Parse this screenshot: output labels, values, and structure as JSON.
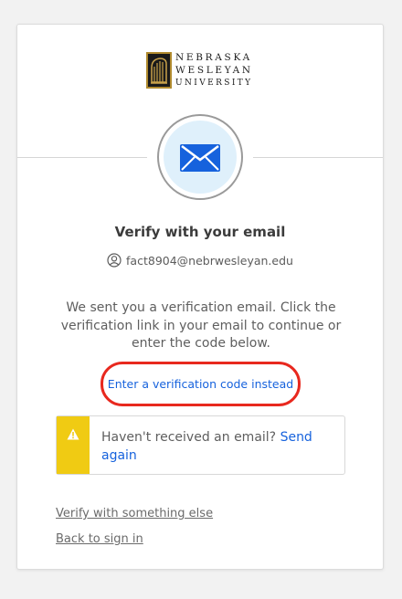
{
  "brand": {
    "line1": "NEBRASKA",
    "line2": "WESLEYAN",
    "line3": "UNIVERSITY"
  },
  "page": {
    "title": "Verify with your email",
    "identifier": "fact8904@nebrwesleyan.edu",
    "instructions": "We sent you a verification email. Click the verification link in your email to continue or enter the code below.",
    "code_link": "Enter a verification code instead"
  },
  "callout": {
    "message": "Haven't received an email?",
    "action": "Send again"
  },
  "footer": {
    "verify_else": "Verify with something else",
    "back": "Back to sign in"
  },
  "colors": {
    "link": "#1662dd",
    "warning": "#f0cb13",
    "highlight_ring": "#e8281e",
    "email_badge_bg": "#dff0fb"
  },
  "icons": {
    "brand": "university-logo-icon",
    "badge": "envelope-icon",
    "identity": "user-icon",
    "callout": "warning-icon"
  }
}
